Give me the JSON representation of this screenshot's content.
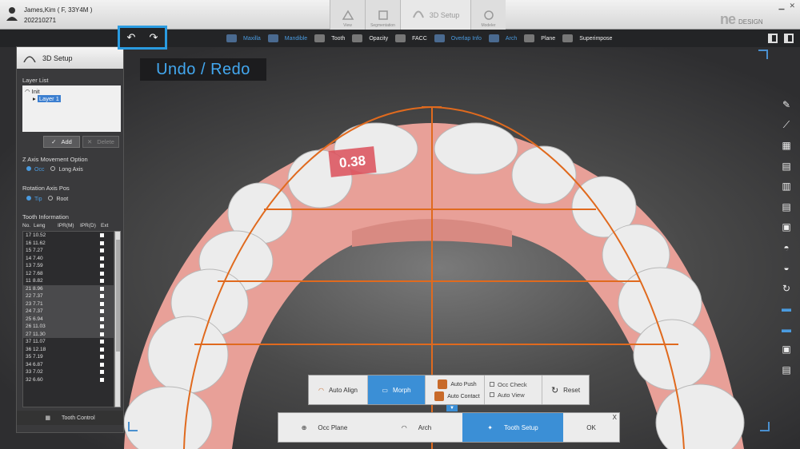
{
  "patient": {
    "name": "James,Kim ( F, 33Y4M )",
    "id": "202210271"
  },
  "mode_tabs": [
    {
      "label": "View",
      "icon": "view-icon"
    },
    {
      "label": "Segmentation",
      "icon": "segmentation-icon"
    },
    {
      "label": "3D Setup",
      "icon": "arch-icon"
    },
    {
      "label": "Modeler",
      "icon": "modeler-icon"
    }
  ],
  "logo": {
    "main": "ne",
    "sub": "DESIGN"
  },
  "toolbar": {
    "undo_icon": "↶",
    "redo_icon": "↷",
    "items": [
      {
        "label": "Maxilla",
        "blue": true
      },
      {
        "label": "Mandible",
        "blue": true
      },
      {
        "label": "Tooth",
        "blue": false
      },
      {
        "label": "Opacity",
        "blue": false
      },
      {
        "label": "FACC",
        "blue": false
      },
      {
        "label": "Overlap Info",
        "blue": true
      },
      {
        "label": "Arch",
        "blue": true
      },
      {
        "label": "Plane",
        "blue": false
      },
      {
        "label": "Superimpose",
        "blue": false
      }
    ]
  },
  "overlay": {
    "undo_redo_label": "Undo / Redo",
    "measurement": "0.38"
  },
  "panel": {
    "title": "3D Setup",
    "layer_list_title": "Layer List",
    "layers": [
      "Init",
      "Layer 1"
    ],
    "add_label": "Add",
    "delete_label": "Delete",
    "z_axis_title": "Z Axis Movement Option",
    "z_axis_options": [
      "Occ",
      "Long Axis"
    ],
    "rotation_title": "Rotation Axis Pos",
    "rotation_options": [
      "Tip",
      "Root"
    ],
    "tooth_info_title": "Tooth Information",
    "columns": [
      "No.",
      "Leng",
      "IPR(M)",
      "IPR(D)",
      "Ext"
    ],
    "teeth": [
      {
        "no": "17",
        "leng": "10.52",
        "shade": false
      },
      {
        "no": "16",
        "leng": "11.62",
        "shade": false
      },
      {
        "no": "15",
        "leng": "7.27",
        "shade": false
      },
      {
        "no": "14",
        "leng": "7.40",
        "shade": false
      },
      {
        "no": "13",
        "leng": "7.59",
        "shade": false
      },
      {
        "no": "12",
        "leng": "7.68",
        "shade": false
      },
      {
        "no": "11",
        "leng": "8.82",
        "shade": false
      },
      {
        "no": "21",
        "leng": "8.96",
        "shade": true
      },
      {
        "no": "22",
        "leng": "7.37",
        "shade": true
      },
      {
        "no": "23",
        "leng": "7.71",
        "shade": true
      },
      {
        "no": "24",
        "leng": "7.37",
        "shade": true
      },
      {
        "no": "25",
        "leng": "6.94",
        "shade": true
      },
      {
        "no": "26",
        "leng": "11.03",
        "shade": true
      },
      {
        "no": "27",
        "leng": "11.30",
        "shade": true
      },
      {
        "no": "37",
        "leng": "11.07",
        "shade": false
      },
      {
        "no": "36",
        "leng": "12.18",
        "shade": false
      },
      {
        "no": "35",
        "leng": "7.19",
        "shade": false
      },
      {
        "no": "34",
        "leng": "6.87",
        "shade": false
      },
      {
        "no": "33",
        "leng": "7.02",
        "shade": false
      },
      {
        "no": "32",
        "leng": "6.60",
        "shade": false
      }
    ],
    "tooth_control_label": "Tooth Control"
  },
  "action_bar": {
    "auto_align": "Auto Align",
    "morph": "Morph",
    "auto_push": "Auto Push",
    "auto_contact": "Auto Contact",
    "occ_check": "Occ Check",
    "auto_view": "Auto View",
    "reset": "Reset"
  },
  "step_bar": {
    "steps": [
      "Occ Plane",
      "Arch",
      "Tooth Setup"
    ],
    "ok": "OK",
    "close": "X"
  },
  "colors": {
    "accent": "#3b8fd6",
    "arch_line": "#e06a1e",
    "gum": "#e8a098"
  }
}
